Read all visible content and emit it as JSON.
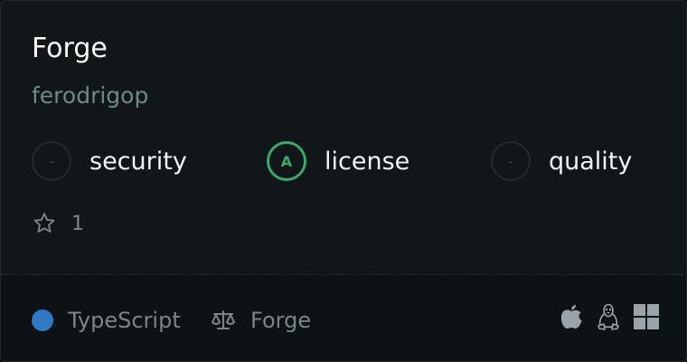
{
  "repo": {
    "name": "Forge",
    "owner": "ferodrigop",
    "stars": "1"
  },
  "scores": [
    {
      "grade": "-",
      "label": "security",
      "state": "empty"
    },
    {
      "grade": "A",
      "label": "license",
      "state": "good"
    },
    {
      "grade": "-",
      "label": "quality",
      "state": "empty"
    }
  ],
  "footer": {
    "language": "TypeScript",
    "language_color": "#3178c6",
    "license": "Forge",
    "platforms": [
      "apple-icon",
      "linux-icon",
      "windows-icon"
    ]
  },
  "colors": {
    "accent_good": "#3aa76d",
    "card_bg": "#111719",
    "footer_bg": "#0d1214"
  }
}
